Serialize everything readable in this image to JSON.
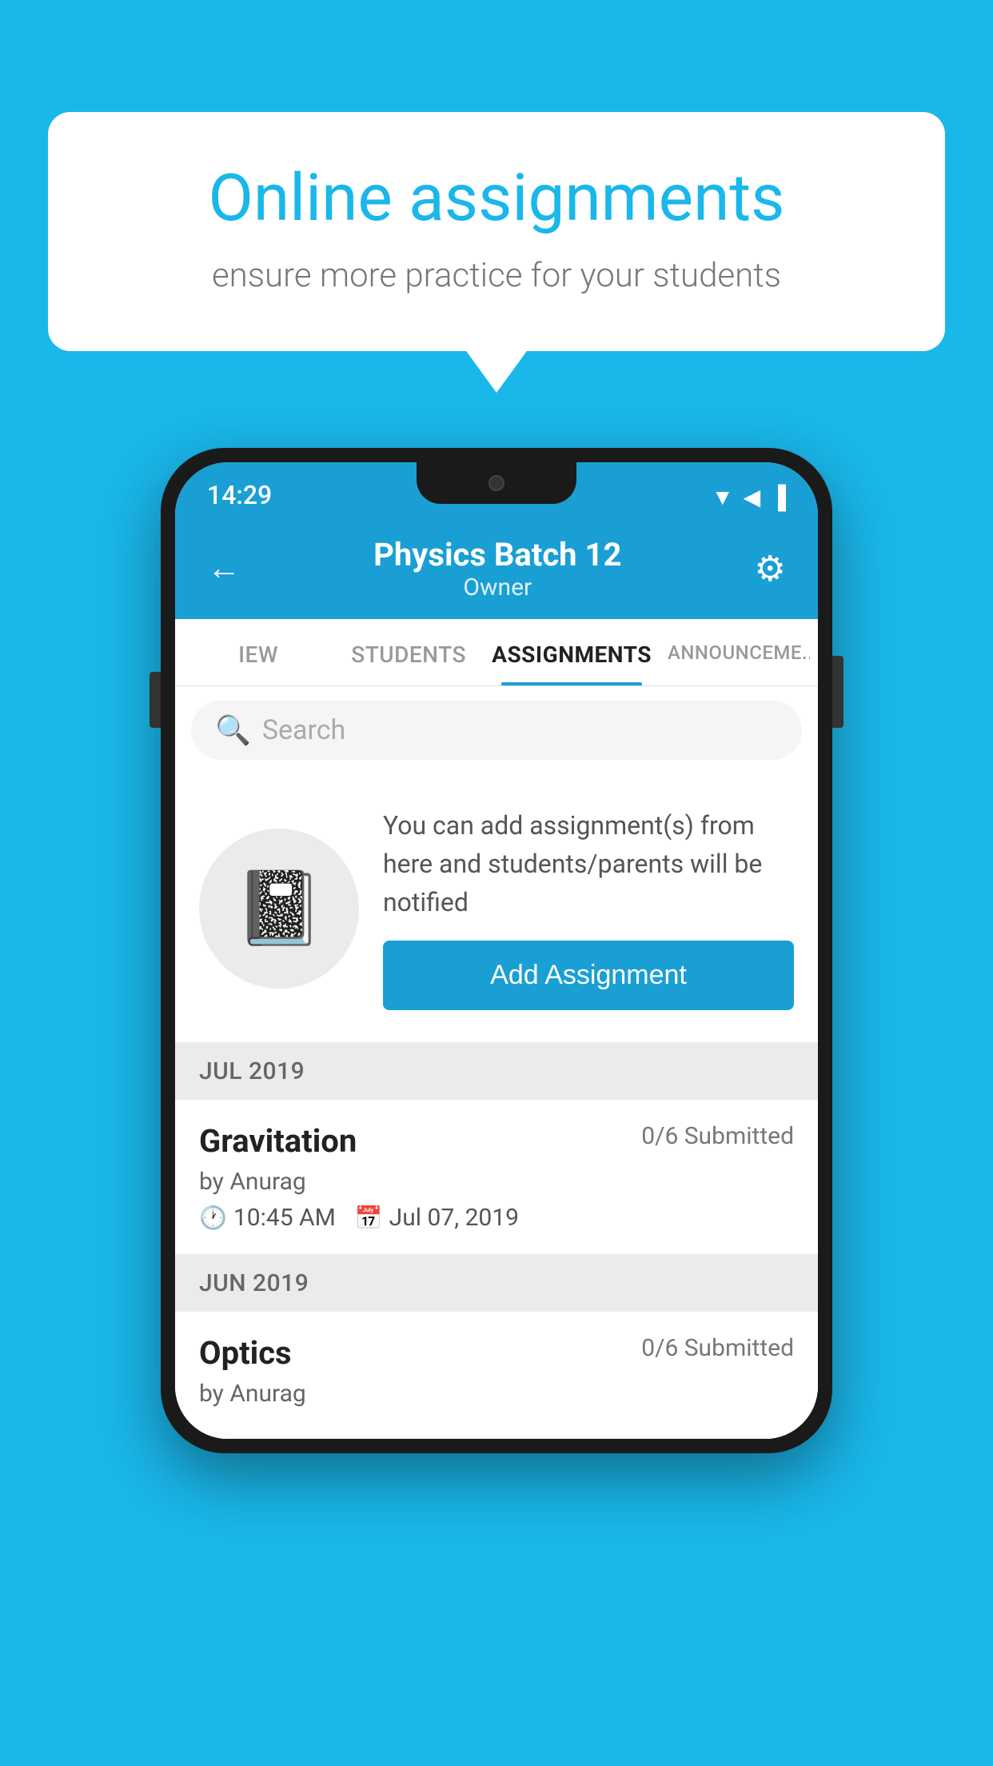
{
  "background": {
    "color": "#1ab7ea"
  },
  "speech_bubble": {
    "title": "Online assignments",
    "subtitle": "ensure more practice for your students"
  },
  "status_bar": {
    "time": "14:29",
    "wifi": "▲",
    "signal": "▲",
    "battery": "▐"
  },
  "app_header": {
    "title": "Physics Batch 12",
    "subtitle": "Owner",
    "back_label": "←",
    "gear_label": "⚙"
  },
  "tabs": [
    {
      "label": "IEW",
      "active": false
    },
    {
      "label": "STUDENTS",
      "active": false
    },
    {
      "label": "ASSIGNMENTS",
      "active": true
    },
    {
      "label": "ANNOUNCEME...",
      "active": false
    }
  ],
  "search": {
    "placeholder": "Search"
  },
  "add_assignment_section": {
    "description": "You can add assignment(s) from here and students/parents will be notified",
    "button_label": "Add Assignment"
  },
  "sections": [
    {
      "label": "JUL 2019",
      "assignments": [
        {
          "name": "Gravitation",
          "submitted": "0/6 Submitted",
          "author": "by Anurag",
          "time": "10:45 AM",
          "date": "Jul 07, 2019"
        }
      ]
    },
    {
      "label": "JUN 2019",
      "assignments": [
        {
          "name": "Optics",
          "submitted": "0/6 Submitted",
          "author": "by Anurag",
          "time": "",
          "date": ""
        }
      ]
    }
  ]
}
